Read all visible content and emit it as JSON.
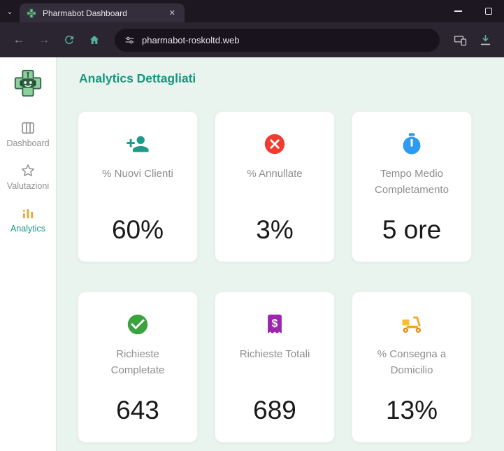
{
  "browser": {
    "tab": {
      "title": "Pharmabot Dashboard",
      "close_icon": "✕",
      "menu_chevron": "⌄"
    },
    "nav": {
      "back_icon": "←",
      "forward_icon": "→"
    },
    "url": "pharmabot-roskoltd.web"
  },
  "sidebar": {
    "items": [
      {
        "id": "dashboard",
        "label": "Dashboard",
        "active": false
      },
      {
        "id": "valutazioni",
        "label": "Valutazioni",
        "active": false
      },
      {
        "id": "analytics",
        "label": "Analytics",
        "active": true
      }
    ]
  },
  "main": {
    "title": "Analytics Dettagliati",
    "cards": [
      {
        "icon": "person-add-icon",
        "label": "% Nuovi Clienti",
        "value": "60%"
      },
      {
        "icon": "cancel-icon",
        "label": "% Annullate",
        "value": "3%"
      },
      {
        "icon": "timer-icon",
        "label": "Tempo Medio Completamento",
        "value": "5 ore"
      },
      {
        "icon": "check-circle-icon",
        "label": "Richieste Completate",
        "value": "643"
      },
      {
        "icon": "receipt-dollar-icon",
        "label": "Richieste Totali",
        "value": "689"
      },
      {
        "icon": "scooter-icon",
        "label": "% Consegna a Domicilio",
        "value": "13%"
      }
    ]
  },
  "colors": {
    "accent_teal": "#15977e",
    "icon_red": "#f23b2f",
    "icon_blue": "#2d9cf0",
    "icon_green": "#3aa23f",
    "icon_purple": "#9b27af",
    "icon_orange": "#f5a623",
    "analytics_icon_orange": "#eda63b"
  }
}
